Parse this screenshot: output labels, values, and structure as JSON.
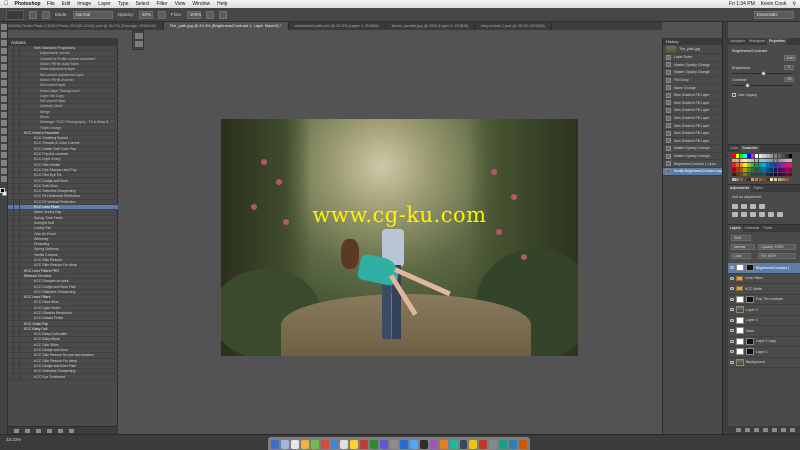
{
  "menubar": {
    "app": "Photoshop",
    "items": [
      "File",
      "Edit",
      "Image",
      "Layer",
      "Type",
      "Select",
      "Filter",
      "View",
      "Window",
      "Help"
    ],
    "title": "Adobe Photoshop CS6",
    "clock": "Fri 1:34 PM",
    "user": "Kevin Cook"
  },
  "options": {
    "mode_label": "Mode:",
    "mode_value": "Normal",
    "opacity_label": "Opacity:",
    "opacity_value": "50%",
    "flow_label": "Flow:",
    "flow_value": "100%",
    "workspace": "Essentials"
  },
  "doc_tabs": [
    "RAHDB-Photo-Photo-CEDM-Photo-2016(D-2016).psd @ 16.7% (Smudge, GRAY/8)*",
    "The_path.jpg @ 33.3% (Brightness/Contrast 1, Layer Mask/8) *",
    "unmasked-path.psd @ 33.3% (Layer 1, RGB/8)",
    "forest_ramble.jpg @ 25% (Layer 0, RGB/8)",
    "fairy-forest-2.psd @ 33.3% (RGB/8)"
  ],
  "watermark": "www.cg-ku.com",
  "status": {
    "zoom": "33.33%"
  },
  "actions": {
    "tab": "Actions",
    "rows": [
      {
        "t": "item",
        "label": "Web Standard Proportions"
      },
      {
        "t": "sub",
        "label": "Adjustment: curves"
      },
      {
        "t": "sub",
        "label": "Convert to Profile current document"
      },
      {
        "t": "sub",
        "label": "Match YRHB study Stars"
      },
      {
        "t": "sub",
        "label": "Make adjustment layer"
      },
      {
        "t": "sub",
        "label": "Set current adjustment layer"
      },
      {
        "t": "sub",
        "label": "Match YRHB channel"
      },
      {
        "t": "sub",
        "label": "Set current layer"
      },
      {
        "t": "sub",
        "label": "Select layer \"Background\""
      },
      {
        "t": "sub",
        "label": "Layer Via Copy"
      },
      {
        "t": "sub",
        "label": "Set current layer"
      },
      {
        "t": "sub",
        "label": "Unsharp Mask"
      },
      {
        "t": "sub",
        "label": "Merge"
      },
      {
        "t": "sub",
        "label": "Show"
      },
      {
        "t": "sub",
        "label": "Message: \"KCC Photography - Fit & Wrap B...\""
      },
      {
        "t": "sub",
        "label": "Flatten Image"
      },
      {
        "t": "folder",
        "label": "KCC Kevin's Favorites"
      },
      {
        "t": "item",
        "label": "KCC Soothing Sunset"
      },
      {
        "t": "item",
        "label": "KCC Smooth & Color Correct"
      },
      {
        "t": "item",
        "label": "KCC Subtle Soft Color Pop"
      },
      {
        "t": "item",
        "label": "KCC Pop the contrast"
      },
      {
        "t": "item",
        "label": "KCC Light Vivery"
      },
      {
        "t": "item",
        "label": "KCC Rich Infrate"
      },
      {
        "t": "item",
        "label": "KCC Eye Sharpen and Pop"
      },
      {
        "t": "item",
        "label": "KCC Red Eye Fix"
      },
      {
        "t": "item",
        "label": "KCC Dodge and Burn"
      },
      {
        "t": "item",
        "label": "KCC Soft Glow"
      },
      {
        "t": "item",
        "label": "KCC Selective Sharpening"
      },
      {
        "t": "item",
        "label": "KCC Fit Horizontal Perfection"
      },
      {
        "t": "item",
        "label": "KCC Fit Vertical Perfection"
      },
      {
        "t": "item",
        "label": "KCC Lens Flare"
      },
      {
        "t": "item",
        "label": "Warm Sunny Day"
      },
      {
        "t": "item",
        "label": "Spring Time Fresh"
      },
      {
        "t": "item",
        "label": "Sunlight Soft"
      },
      {
        "t": "item",
        "label": "Lovely Fall"
      },
      {
        "t": "item",
        "label": "Chic Air Fresh"
      },
      {
        "t": "item",
        "label": "Whimsey"
      },
      {
        "t": "item",
        "label": "Dreaming"
      },
      {
        "t": "item",
        "label": "Spring Softness"
      },
      {
        "t": "item",
        "label": "Vanilla Creams"
      },
      {
        "t": "item",
        "label": "KCC Skin Rescue"
      },
      {
        "t": "item",
        "label": "KCC Skin Rescue For deep"
      },
      {
        "t": "folder",
        "label": "KCC Lens Filters PRO"
      },
      {
        "t": "folder",
        "label": "Retouch On color"
      },
      {
        "t": "item",
        "label": "KCC Sharpen for print"
      },
      {
        "t": "item",
        "label": "KCC Dodge and Burn Fast"
      },
      {
        "t": "item",
        "label": "KCC Selective Sharpening"
      },
      {
        "t": "folder",
        "label": "KCC Lens Filters"
      },
      {
        "t": "item",
        "label": "KCC Haze Blue"
      },
      {
        "t": "item",
        "label": "KCC Light Vision"
      },
      {
        "t": "item",
        "label": "KCC Shadow Reduction"
      },
      {
        "t": "item",
        "label": "KCC Instant Finish"
      },
      {
        "t": "folder",
        "label": "KCC Smile Pop"
      },
      {
        "t": "folder",
        "label": "KCC Baby Doll"
      },
      {
        "t": "item",
        "label": "KCC Baby Doll matte"
      },
      {
        "t": "item",
        "label": "KCC Baby Blush"
      },
      {
        "t": "item",
        "label": "KCC Skin Silica"
      },
      {
        "t": "item",
        "label": "KCC Dodge and Burn"
      },
      {
        "t": "item",
        "label": "KCC Skin Rescue for eye and shadow"
      },
      {
        "t": "item",
        "label": "KCC Skin Rescue For deep"
      },
      {
        "t": "item",
        "label": "KCC Dodge and Burn Fast"
      },
      {
        "t": "item",
        "label": "KCC Selective Sharpening"
      },
      {
        "t": "item",
        "label": "KCC Eye Treatment"
      }
    ],
    "selected_index": 30
  },
  "history": {
    "tab": "History",
    "snapshot": "The_path.jpg",
    "rows": [
      "Layer Order",
      "Master Opacity Change",
      "Master Opacity Change",
      "Fill Group",
      "Name Change",
      "New Gradient Fill Layer",
      "New Gradient Fill Layer",
      "New Gradient Fill Layer",
      "New Gradient Fill Layer",
      "New Gradient Fill Layer",
      "New Gradient Fill Layer",
      "New Gradient Fill Layer",
      "Master Opacity Change",
      "Master Opacity Change",
      "Brightness/Contrast 1 Layer",
      "Modify Brightness/Contrast Layer"
    ],
    "current_index": 15
  },
  "properties": {
    "tabs": [
      "Navigator",
      "Histogram",
      "Properties"
    ],
    "active_tab": 2,
    "title": "Brightness/Contrast",
    "auto_label": "Auto",
    "brightness_label": "Brightness:",
    "brightness_value": "0",
    "contrast_label": "Contrast:",
    "contrast_value": "-50",
    "legacy_label": "Use Legacy"
  },
  "swatches": {
    "tabs": [
      "Color",
      "Swatches"
    ],
    "colors": [
      "#ff0000",
      "#ffff00",
      "#00ff00",
      "#00ffff",
      "#0000ff",
      "#ff00ff",
      "#ffffff",
      "#e6e6e6",
      "#cccccc",
      "#b3b3b3",
      "#999999",
      "#808080",
      "#666666",
      "#4d4d4d",
      "#333333",
      "#000000",
      "#f7977a",
      "#fbad82",
      "#fdc68c",
      "#fff79a",
      "#c4df9b",
      "#a2d39c",
      "#82ca9d",
      "#7bcdc8",
      "#6ecff6",
      "#7ea7d8",
      "#8493ca",
      "#8882be",
      "#a187be",
      "#bc8dbf",
      "#f49ac2",
      "#f6989d",
      "#ed1c24",
      "#f26522",
      "#f7941d",
      "#fff200",
      "#8dc63f",
      "#39b54a",
      "#00a651",
      "#00a99d",
      "#00aeef",
      "#0072bc",
      "#0054a6",
      "#2e3192",
      "#662d91",
      "#92278f",
      "#ec008c",
      "#ed145b",
      "#9e0b0f",
      "#a0410d",
      "#a3620a",
      "#aba000",
      "#598527",
      "#1a7b30",
      "#007236",
      "#00746b",
      "#0076a3",
      "#004b80",
      "#003471",
      "#1b1464",
      "#440e62",
      "#630460",
      "#9e005d",
      "#9e0039",
      "#790000",
      "#7b2e00",
      "#7d4900",
      "#827b00",
      "#406618",
      "#005e20",
      "#005826",
      "#005952",
      "#005b7f",
      "#003663",
      "#002157",
      "#0d004c",
      "#32004b",
      "#4b0049",
      "#7b0046",
      "#7a0026",
      "#c7b299",
      "#998675",
      "#736357",
      "#534741",
      "#37302d",
      "#c69c6d",
      "#a67c52",
      "#8c6239",
      "#754c24",
      "#603913",
      "#f0e6d2",
      "#d9c8a9",
      "#bfa77a",
      "#a3855d",
      "#826a44",
      "#5e4b2d"
    ]
  },
  "adjustments": {
    "tabs": [
      "Adjustments",
      "Styles"
    ],
    "label": "Add an adjustment"
  },
  "layers": {
    "tabs": [
      "Layers",
      "Channels",
      "Paths"
    ],
    "kind": "Kind",
    "blend": "Normal",
    "opacity": "Opacity: 100%",
    "lock": "Lock:",
    "fill": "Fill: 100%",
    "items": [
      {
        "name": "Brightness/Contrast 1",
        "thumb": "white",
        "mask": true,
        "selected": true
      },
      {
        "name": "Lens Filters",
        "thumb": "group",
        "mask": false
      },
      {
        "name": "KCC Matte",
        "thumb": "group",
        "mask": false
      },
      {
        "name": "Pop The contrast",
        "thumb": "white",
        "mask": true
      },
      {
        "name": "Layer 3",
        "thumb": "photo",
        "mask": false
      },
      {
        "name": "Layer 2",
        "thumb": "white",
        "mask": false
      },
      {
        "name": "Haze",
        "thumb": "white",
        "mask": false
      },
      {
        "name": "Layer 1 copy",
        "thumb": "white",
        "mask": true
      },
      {
        "name": "Layer 1",
        "thumb": "white",
        "mask": true
      },
      {
        "name": "Background",
        "thumb": "photo",
        "mask": false
      }
    ]
  },
  "dock_colors": [
    "#3a6ec9",
    "#9fb8d8",
    "#e6e6e6",
    "#f2b33d",
    "#6fbf4a",
    "#d94a3a",
    "#3c88d6",
    "#e0e0e0",
    "#ffd42a",
    "#c43a3a",
    "#2a8c2a",
    "#5a5ad6",
    "#8c8c8c",
    "#1f6fd6",
    "#4da6ff",
    "#2c2c2c",
    "#9b59b6",
    "#e67e22",
    "#1abc9c",
    "#34495e",
    "#f1c40f",
    "#c0392b",
    "#7f8c8d",
    "#16a085",
    "#2980b9",
    "#d35400"
  ]
}
